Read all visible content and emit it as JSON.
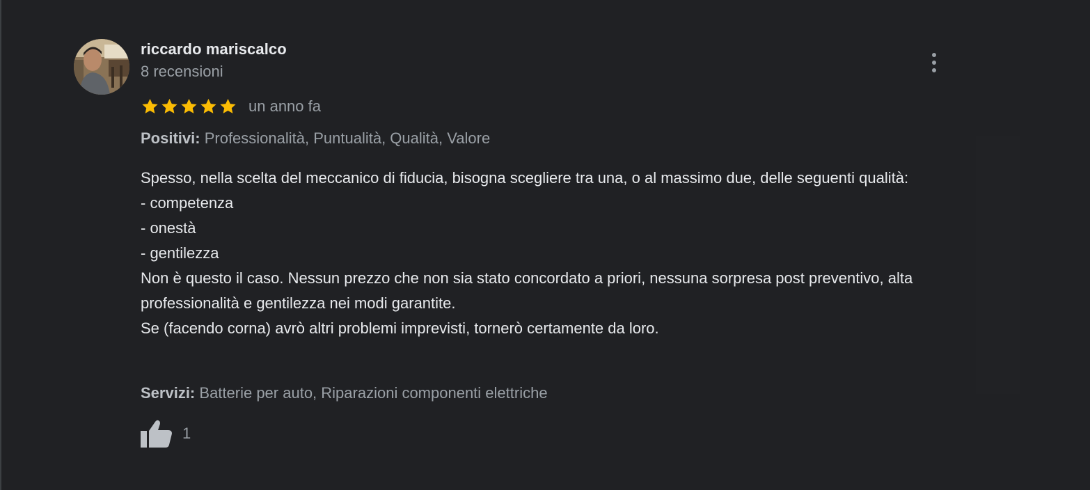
{
  "review": {
    "author": "riccardo mariscalco",
    "review_count": "8 recensioni",
    "rating": 5,
    "rating_max": 5,
    "date": "un anno fa",
    "positives_label": "Positivi:",
    "positives_value": "Professionalità, Puntualità, Qualità, Valore",
    "text": "Spesso, nella scelta del meccanico di fiducia, bisogna scegliere tra una, o al massimo due, delle seguenti qualità:\n- competenza\n- onestà\n- gentilezza\nNon è questo il caso. Nessun prezzo che non sia stato concordato a priori, nessuna sorpresa post preventivo, alta professionalità e gentilezza nei modi garantite.\nSe (facendo corna) avrò altri problemi imprevisti, tornerò certamente da loro.",
    "services_label": "Servizi:",
    "services_value": "Batterie per auto, Riparazioni componenti elettriche",
    "likes": "1"
  },
  "icons": {
    "star": "star-icon",
    "menu": "more-vert-icon",
    "like": "thumb-up-icon"
  },
  "colors": {
    "background": "#202124",
    "star": "#fbbc04",
    "text_primary": "#e8eaed",
    "text_secondary": "#9aa0a6"
  }
}
